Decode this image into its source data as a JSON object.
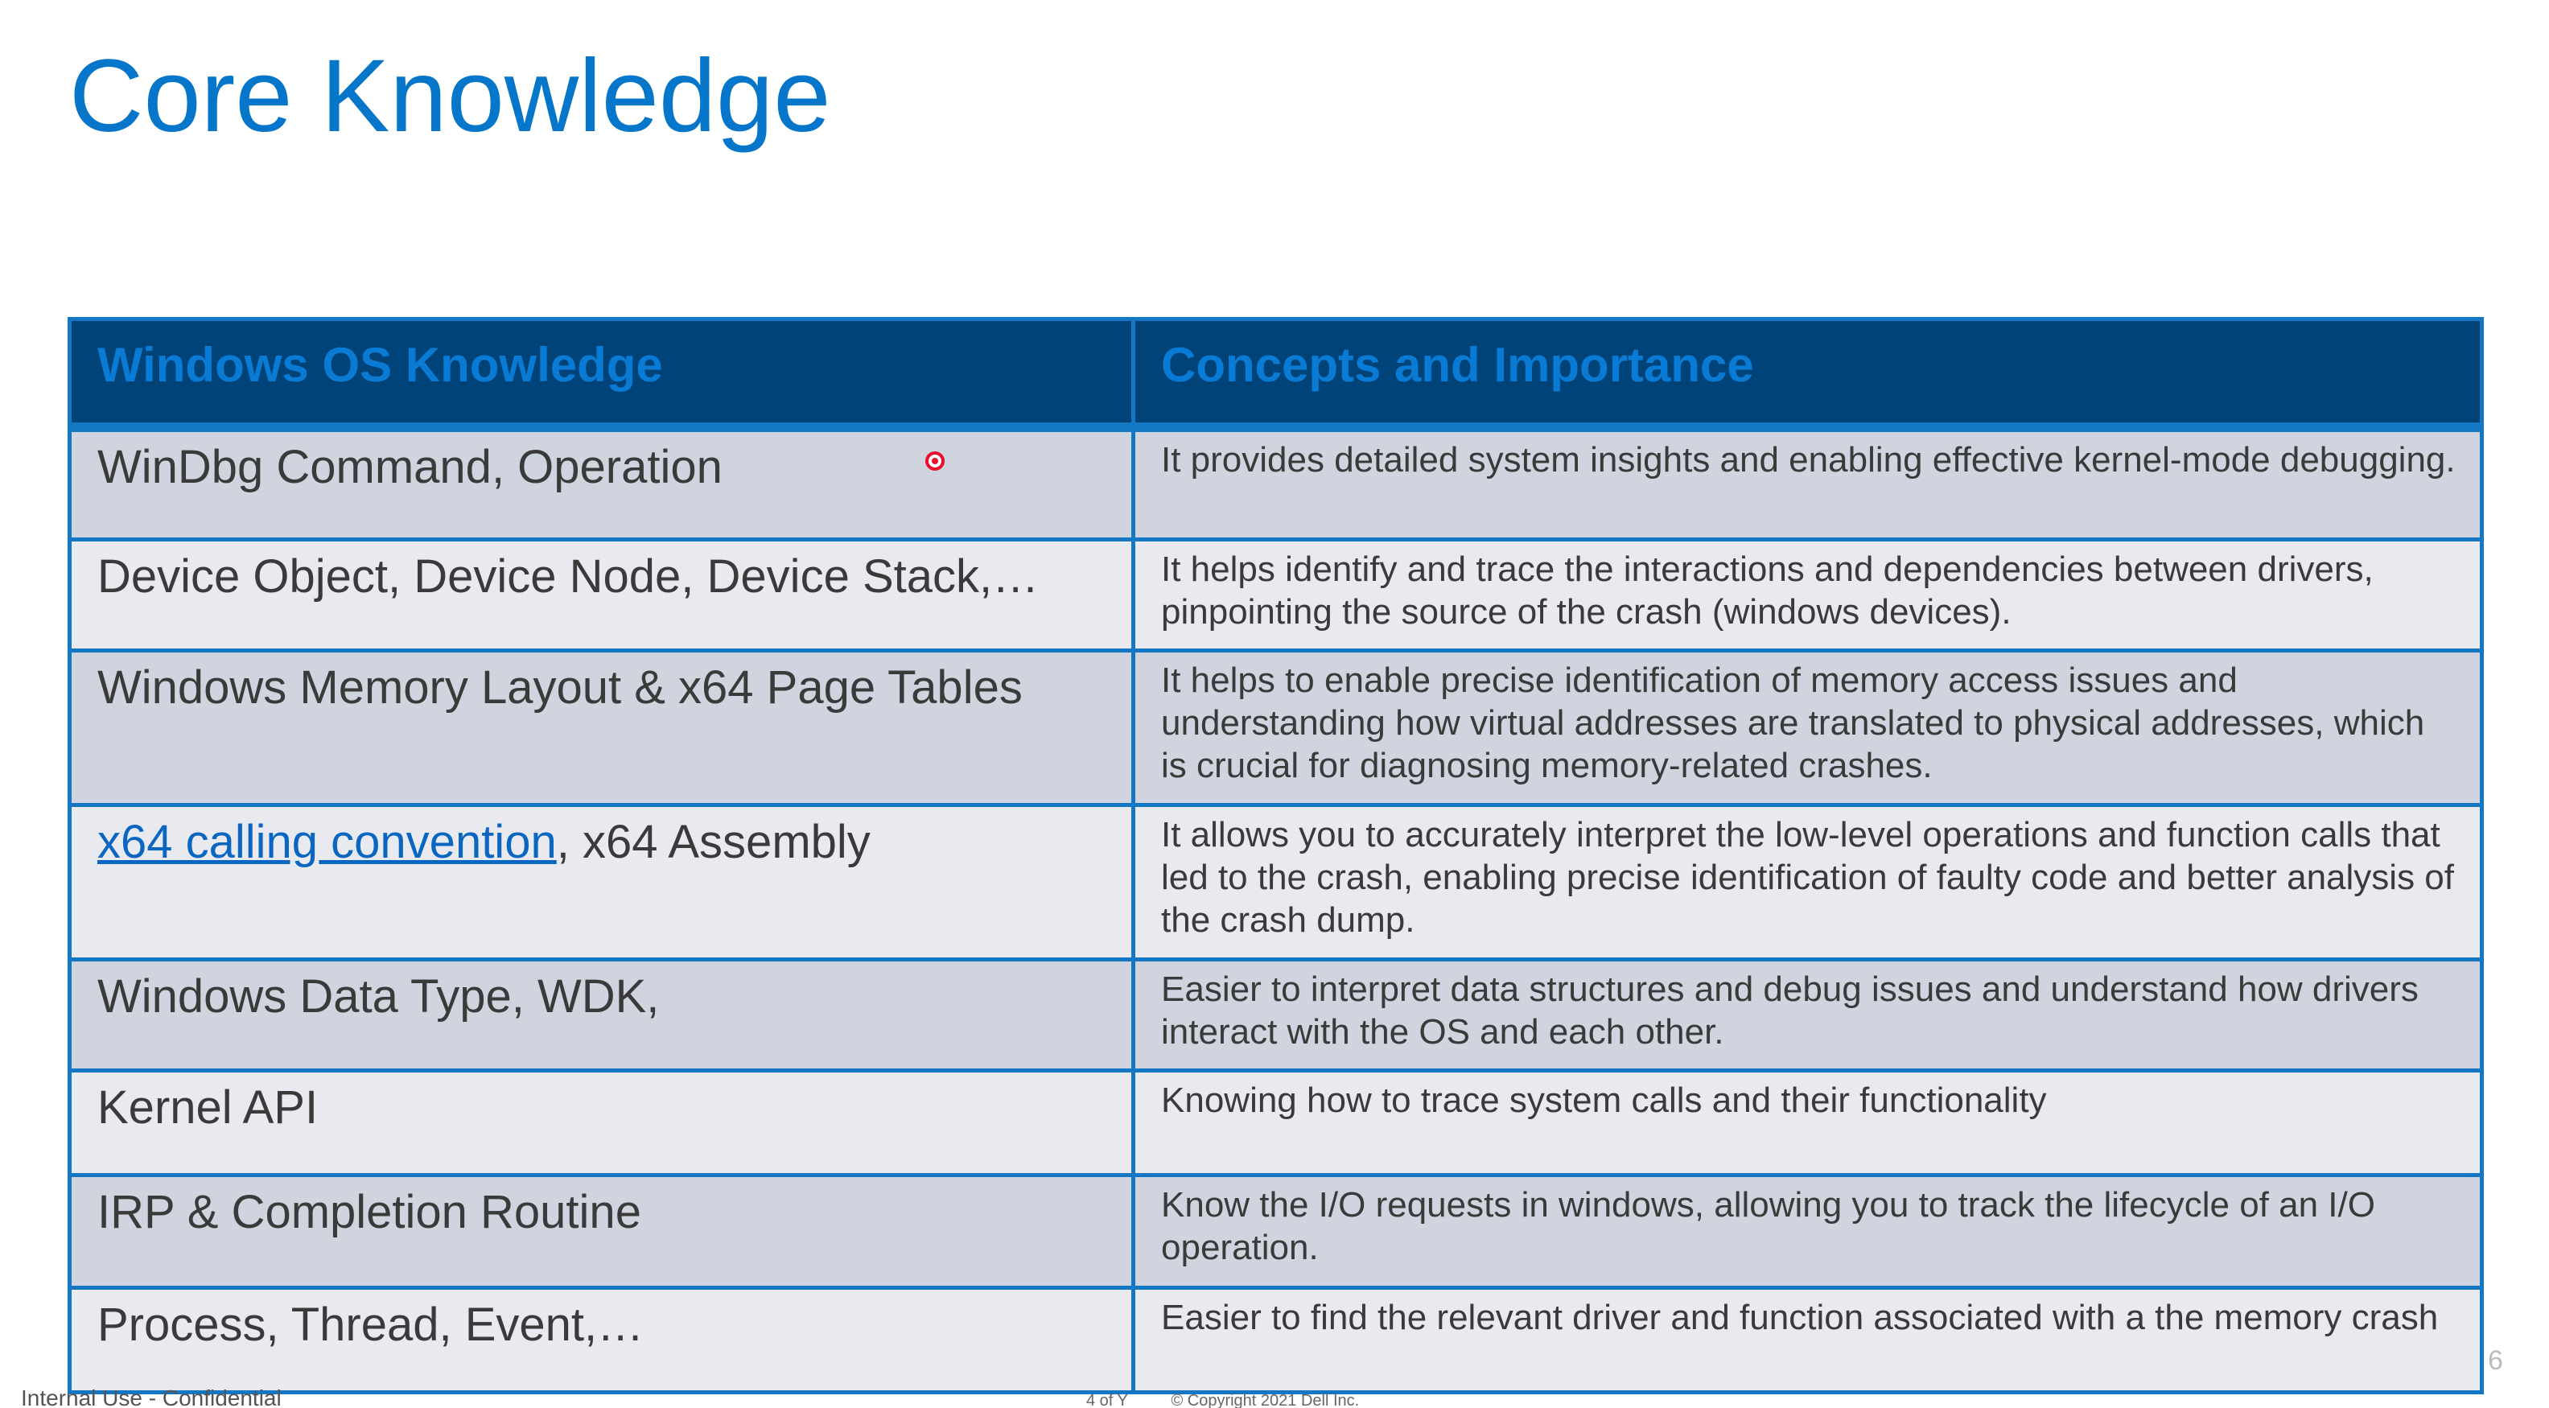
{
  "slide": {
    "title": "Core Knowledge",
    "table": {
      "headers": [
        "Windows OS Knowledge",
        "Concepts and Importance"
      ],
      "rows": [
        {
          "topic": "WinDbg Command, Operation",
          "concept": "It provides detailed system insights and enabling effective kernel-mode debugging."
        },
        {
          "topic": "Device Object, Device Node, Device Stack,…",
          "concept": "It helps identify and trace the interactions and dependencies between drivers, pinpointing the source of the crash (windows devices)."
        },
        {
          "topic": "Windows Memory Layout & x64 Page Tables",
          "concept": "It helps to enable precise identification of memory access issues and understanding how virtual addresses are translated to physical addresses, which is crucial for diagnosing memory-related crashes."
        },
        {
          "topic_link": "x64 calling convention",
          "topic_rest": ", x64 Assembly",
          "concept": "It allows you to accurately interpret the low-level operations and function calls that led to the crash, enabling precise identification of faulty code and better analysis of the crash dump."
        },
        {
          "topic": "Windows Data Type, WDK,",
          "concept": "Easier to interpret data structures and debug issues and understand how drivers interact with the OS and each other."
        },
        {
          "topic": "Kernel API",
          "concept": "Knowing how to trace system calls and their functionality"
        },
        {
          "topic": "IRP & Completion Routine",
          "concept": "Know the I/O requests in windows, allowing you to track the lifecycle of an I/O operation."
        },
        {
          "topic": "Process, Thread, Event,…",
          "concept": "Easier to find the relevant driver and function associated with a the memory crash"
        }
      ]
    },
    "footer": {
      "classification": "Internal Use - Confidential",
      "page_of": "4 of Y",
      "copyright": "© Copyright 2021 Dell Inc.",
      "page_number": "6"
    }
  },
  "colors": {
    "title": "#0576c9",
    "header_bg": "#004379",
    "header_text": "#0a7bd4",
    "border": "#1477c4",
    "row_odd": "#cfd4de",
    "row_even": "#e8eaf0",
    "link": "#0a66c0",
    "pointer": "#e8102a"
  }
}
